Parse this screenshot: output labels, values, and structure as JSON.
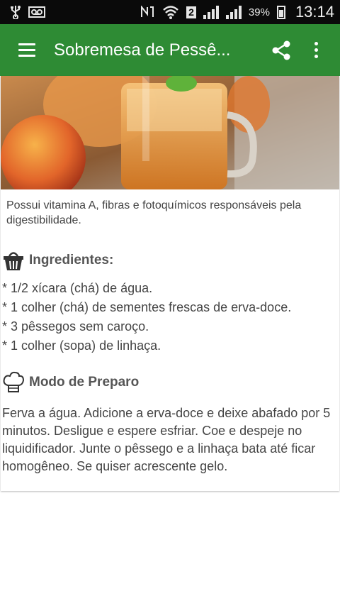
{
  "status_bar": {
    "left_icons": [
      "usb-icon",
      "voicemail-icon"
    ],
    "right_icons": [
      "nfc-icon",
      "wifi-icon",
      "sim2-icon",
      "signal-icon",
      "signal-icon",
      "battery-icon"
    ],
    "sim_label": "2",
    "battery_percent": "39%",
    "time": "13:14"
  },
  "app_bar": {
    "title": "Sobremesa de Pessê...",
    "menu_icon": "hamburger-menu-icon",
    "share_icon": "share-icon",
    "more_icon": "more-vert-icon",
    "color": "#2e8b34"
  },
  "recipe": {
    "intro": "Possui vitamina A, fibras e fotoquímicos responsáveis pela digestibilidade.",
    "ingredients_title": "Ingredientes:",
    "ingredients_icon": "basket-icon",
    "ingredients": [
      "* 1/2 xícara (chá) de água.",
      "* 1 colher (chá) de sementes frescas de erva-doce.",
      "* 3 pêssegos sem caroço.",
      "* 1 colher (sopa) de linhaça."
    ],
    "prep_title": "Modo de Preparo",
    "prep_icon": "chef-hat-icon",
    "prep_text": "Ferva a água. Adicione a erva-doce e deixe abafado por 5 minutos. Desligue e espere esfriar. Coe e despeje no liquidificador. Junte o pêssego e a linhaça bata até ficar homogêneo. Se quiser acrescente gelo."
  }
}
